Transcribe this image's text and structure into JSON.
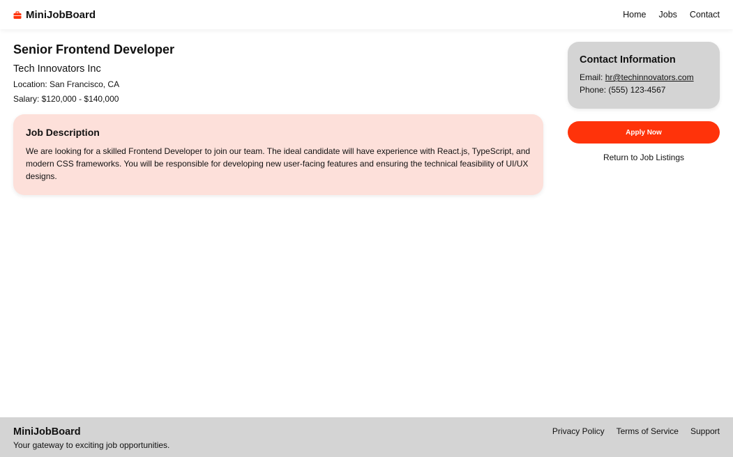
{
  "header": {
    "brand_icon": "briefcase-icon",
    "brand_name": "MiniJobBoard",
    "nav": [
      "Home",
      "Jobs",
      "Contact"
    ]
  },
  "job": {
    "title": "Senior Frontend Developer",
    "company": "Tech Innovators Inc",
    "location": "Location: San Francisco, CA",
    "salary": "Salary: $120,000 - $140,000",
    "description_title": "Job Description",
    "description": "We are looking for a skilled Frontend Developer to join our team. The ideal candidate will have experience with React.js, TypeScript, and modern CSS frameworks. You will be responsible for developing new user-facing features and ensuring the technical feasibility of UI/UX designs."
  },
  "contact": {
    "title": "Contact Information",
    "email_label": "Email: ",
    "email": "hr@techinnovators.com",
    "phone": "Phone: (555) 123-4567"
  },
  "actions": {
    "apply": "Apply Now",
    "return": "Return to Job Listings"
  },
  "footer": {
    "brand_name": "MiniJobBoard",
    "tagline": "Your gateway to exciting job opportunities.",
    "links": [
      "Privacy Policy",
      "Terms of Service",
      "Support"
    ]
  },
  "colors": {
    "accent": "#ff330a",
    "description_bg": "#fde0da",
    "card_bg": "#d4d4d4",
    "footer_bg": "#d4d4d4"
  }
}
